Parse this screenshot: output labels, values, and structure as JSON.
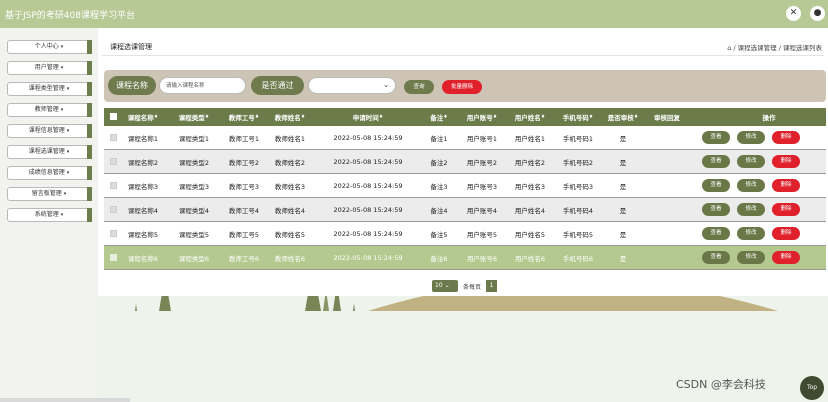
{
  "app": {
    "title": "基于JSP的考研408课程学习平台"
  },
  "icons": {
    "expand": "expand-icon",
    "user": "user-icon",
    "home": "home-icon"
  },
  "colors": {
    "topbar": "#b7c994",
    "accent": "#6b7b4a",
    "danger": "#e0202a",
    "highlight": "#b4c98f"
  },
  "sidebar": {
    "items": [
      {
        "label": "个人中心"
      },
      {
        "label": "用户管理"
      },
      {
        "label": "课程类型管理"
      },
      {
        "label": "教师管理"
      },
      {
        "label": "课程信息管理"
      },
      {
        "label": "课程选课管理"
      },
      {
        "label": "成绩信息管理"
      },
      {
        "label": "留言板管理"
      },
      {
        "label": "系统管理"
      }
    ]
  },
  "page": {
    "title": "课程选课管理",
    "breadcrumb": "/ 课程选课管理 / 课程选课列表"
  },
  "search": {
    "label_name": "课程名称",
    "placeholder": "请输入课程名称",
    "label_passed": "是否通过",
    "query_label": "查询",
    "batch_delete_label": "批量删除"
  },
  "table": {
    "headers": [
      "课程名称",
      "课程类型",
      "教师工号",
      "教师姓名",
      "申请时间",
      "备注",
      "用户账号",
      "用户姓名",
      "手机号码",
      "是否审核",
      "审核回复",
      "操作"
    ],
    "sort_mark": "♦",
    "rows": [
      [
        "课程名称1",
        "课程类型1",
        "教师工号1",
        "教师姓名1",
        "2022-05-08 15:24:59",
        "备注1",
        "用户账号1",
        "用户姓名1",
        "手机号码1",
        "是",
        ""
      ],
      [
        "课程名称2",
        "课程类型2",
        "教师工号2",
        "教师姓名2",
        "2022-05-08 15:24:59",
        "备注2",
        "用户账号2",
        "用户姓名2",
        "手机号码2",
        "是",
        ""
      ],
      [
        "课程名称3",
        "课程类型3",
        "教师工号3",
        "教师姓名3",
        "2022-05-08 15:24:59",
        "备注3",
        "用户账号3",
        "用户姓名3",
        "手机号码3",
        "是",
        ""
      ],
      [
        "课程名称4",
        "课程类型4",
        "教师工号4",
        "教师姓名4",
        "2022-05-08 15:24:59",
        "备注4",
        "用户账号4",
        "用户姓名4",
        "手机号码4",
        "是",
        ""
      ],
      [
        "课程名称5",
        "课程类型5",
        "教师工号5",
        "教师姓名5",
        "2022-05-08 15:24:59",
        "备注5",
        "用户账号5",
        "用户姓名5",
        "手机号码5",
        "是",
        ""
      ],
      [
        "课程名称6",
        "课程类型6",
        "教师工号6",
        "教师姓名6",
        "2022-05-08 15:24:59",
        "备注6",
        "用户账号6",
        "用户姓名6",
        "手机号码6",
        "是",
        ""
      ]
    ],
    "actions": {
      "view": "查看",
      "edit": "修改",
      "delete": "删除"
    }
  },
  "pager": {
    "page_size": "10",
    "per_page_label": "条每页",
    "current_page": "1"
  },
  "footer": {
    "watermark": "CSDN @李会科技",
    "top_label": "Top"
  }
}
